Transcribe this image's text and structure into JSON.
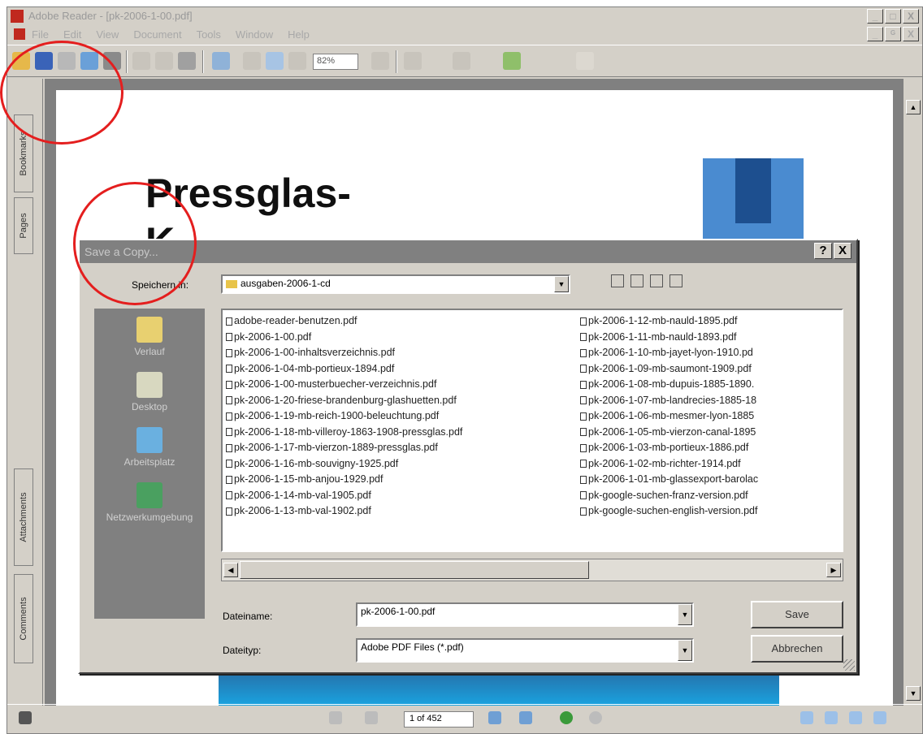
{
  "window": {
    "title": "Adobe Reader - [pk-2006-1-00.pdf]",
    "controls": [
      "_",
      "□",
      "X"
    ],
    "mdi_controls": [
      "_",
      "ᴳ",
      "X"
    ]
  },
  "menu": [
    "File",
    "Edit",
    "View",
    "Document",
    "Tools",
    "Window",
    "Help"
  ],
  "toolbar": {
    "zoom": "82%"
  },
  "side_tabs": [
    "Bookmarks",
    "Pages",
    "Attachments",
    "Comments"
  ],
  "document": {
    "title_line1": "Pressglas-",
    "title_line2": "K"
  },
  "status": {
    "page": "1 of 452"
  },
  "dialog": {
    "title": "Save a Copy...",
    "help": "?",
    "close": "X",
    "save_in_label": "Speichern in:",
    "save_in_value": "ausgaben-2006-1-cd",
    "places": [
      "Verlauf",
      "Desktop",
      "Arbeitsplatz",
      "Netzwerkumgebung"
    ],
    "files_left": [
      "adobe-reader-benutzen.pdf",
      "pk-2006-1-00.pdf",
      "pk-2006-1-00-inhaltsverzeichnis.pdf",
      "pk-2006-1-04-mb-portieux-1894.pdf",
      "pk-2006-1-00-musterbuecher-verzeichnis.pdf",
      "pk-2006-1-20-friese-brandenburg-glashuetten.pdf",
      "pk-2006-1-19-mb-reich-1900-beleuchtung.pdf",
      "pk-2006-1-18-mb-villeroy-1863-1908-pressglas.pdf",
      "pk-2006-1-17-mb-vierzon-1889-pressglas.pdf",
      "pk-2006-1-16-mb-souvigny-1925.pdf",
      "pk-2006-1-15-mb-anjou-1929.pdf",
      "pk-2006-1-14-mb-val-1905.pdf",
      "pk-2006-1-13-mb-val-1902.pdf"
    ],
    "files_right": [
      "pk-2006-1-12-mb-nauld-1895.pdf",
      "pk-2006-1-11-mb-nauld-1893.pdf",
      "pk-2006-1-10-mb-jayet-lyon-1910.pd",
      "pk-2006-1-09-mb-saumont-1909.pdf",
      "pk-2006-1-08-mb-dupuis-1885-1890.",
      "pk-2006-1-07-mb-landrecies-1885-18",
      "pk-2006-1-06-mb-mesmer-lyon-1885",
      "pk-2006-1-05-mb-vierzon-canal-1895",
      "pk-2006-1-03-mb-portieux-1886.pdf",
      "pk-2006-1-02-mb-richter-1914.pdf",
      "pk-2006-1-01-mb-glassexport-barolac",
      "pk-google-suchen-franz-version.pdf",
      "pk-google-suchen-english-version.pdf"
    ],
    "filename_label": "Dateiname:",
    "filename_value": "pk-2006-1-00.pdf",
    "filetype_label": "Dateityp:",
    "filetype_value": "Adobe PDF Files (*.pdf)",
    "save_label": "Save",
    "cancel_label": "Abbrechen"
  },
  "colors": {
    "annotation": "#e41e1e",
    "dialog_bg": "#d4d0c8",
    "places_bg": "#808080"
  }
}
